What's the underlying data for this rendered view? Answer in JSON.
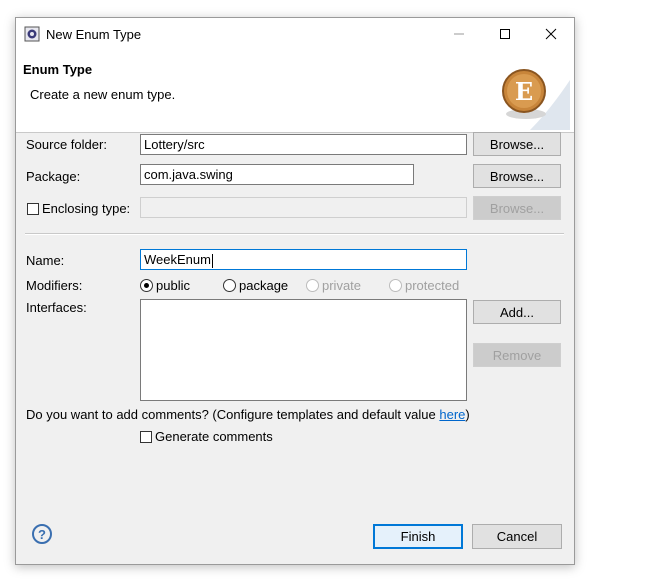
{
  "window": {
    "title": "New Enum Type",
    "icon": "eclipse-icon"
  },
  "banner": {
    "title": "Enum Type",
    "description": "Create a new enum type.",
    "image_letter": "E"
  },
  "form": {
    "source_folder": {
      "label": "Source folder:",
      "value": "Lottery/src",
      "browse_label": "Browse..."
    },
    "package": {
      "label": "Package:",
      "value": "com.java.swing",
      "browse_label": "Browse..."
    },
    "enclosing_type": {
      "label": "Enclosing type:",
      "checked": false,
      "value": "",
      "browse_label": "Browse..."
    },
    "name": {
      "label": "Name:",
      "value": "WeekEnum"
    },
    "modifiers": {
      "label": "Modifiers:",
      "options": [
        {
          "label": "public",
          "selected": true,
          "enabled": true
        },
        {
          "label": "package",
          "selected": false,
          "enabled": true
        },
        {
          "label": "private",
          "selected": false,
          "enabled": false
        },
        {
          "label": "protected",
          "selected": false,
          "enabled": false
        }
      ]
    },
    "interfaces": {
      "label": "Interfaces:",
      "add_label": "Add...",
      "remove_label": "Remove"
    },
    "comments": {
      "question": "Do you want to add comments? (Configure templates and default value ",
      "link": "here",
      "close_paren": ")",
      "generate_label": "Generate comments",
      "generate_checked": false
    }
  },
  "footer": {
    "help_symbol": "?",
    "finish_label": "Finish",
    "cancel_label": "Cancel"
  },
  "colors": {
    "accent": "#0078d7",
    "link": "#0066cc",
    "banner_badge": "#c8853a"
  }
}
